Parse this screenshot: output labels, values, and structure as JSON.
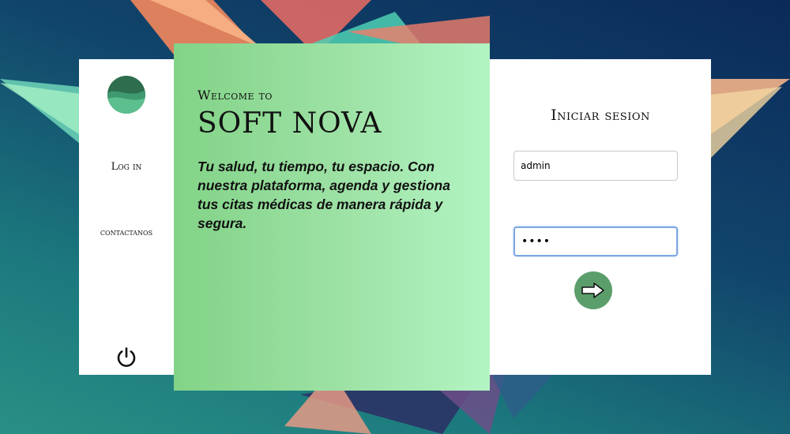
{
  "colors": {
    "accent": "#5b9e6c",
    "hero_gradient_start": "#82d387",
    "hero_gradient_end": "#b3f4c3",
    "panel": "#ffffff",
    "focus_border": "#7ea6e0"
  },
  "sidebar": {
    "logo_icon": "wave-circle-logo",
    "nav_login": "Log in",
    "nav_contact": "contactanos",
    "power_icon": "power-icon"
  },
  "hero": {
    "welcome": "Welcome to",
    "title": "SOFT NOVA",
    "tagline": "Tu salud, tu tiempo, tu espacio. Con nuestra plataforma, agenda y gestiona tus citas médicas de manera rápida y segura."
  },
  "login": {
    "title": "Iniciar sesion",
    "username_value": "admin",
    "password_value": "••••",
    "submit_icon": "arrow-right-icon"
  }
}
